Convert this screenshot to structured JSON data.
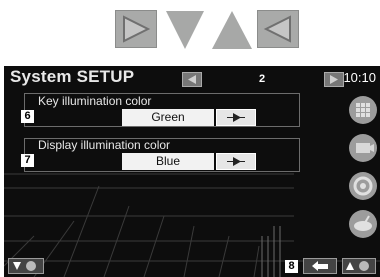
{
  "screen": {
    "title": "System SETUP",
    "page_number": "2",
    "clock": "10:10"
  },
  "rows": [
    {
      "badge": "6",
      "label": "Key illumination color",
      "value": "Green"
    },
    {
      "badge": "7",
      "label": "Display illumination color",
      "value": "Blue"
    }
  ],
  "bottom": {
    "return_badge": "8"
  },
  "icons": {
    "nav_right": "play-right-icon",
    "nav_down": "triangle-down-icon",
    "nav_up": "triangle-up-icon",
    "nav_left": "play-left-icon",
    "return": "return-icon",
    "side": [
      "grid-menu-icon",
      "film-icon",
      "speaker-icon",
      "satellite-icon"
    ]
  },
  "colors": {
    "screen_bg": "#0d0d0d",
    "nav_gray": "#a9aaa9"
  }
}
